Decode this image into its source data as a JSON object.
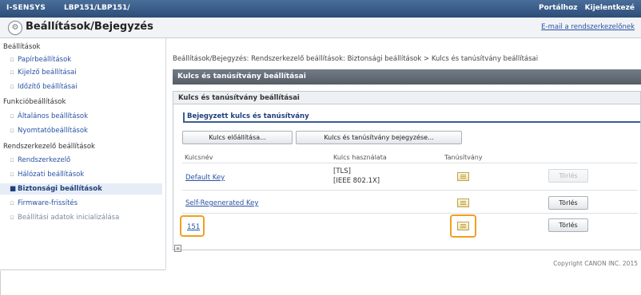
{
  "topbar": {
    "brand": "I-SENSYS",
    "model": "LBP151/LBP151/",
    "links": [
      "Portálhoz",
      "Kijelentkezé"
    ]
  },
  "titlebar": {
    "icon": "gear-icon",
    "title": "Beállítások/Bejegyzés",
    "mail_link": "E-mail a rendszerkezelőnek"
  },
  "sidebar": {
    "groups": [
      {
        "label": "Beállítások",
        "items": [
          "Papírbeállítások",
          "Kijelző beállításai",
          "Időzítő beállításai"
        ]
      },
      {
        "label": "Funkcióbeállítások",
        "items": [
          "Általános beállítások",
          "Nyomtatóbeállítások"
        ]
      },
      {
        "label": "Rendszerkezelő beállítások",
        "items": [
          "Rendszerkezelő",
          "Hálózati beállítások",
          "Biztonsági beállítások",
          "Firmware-frissítés",
          "Beállítási adatok inicializálása"
        ]
      }
    ]
  },
  "breadcrumb": "Beállítások/Bejegyzés: Rendszerkezelő beállítások: Biztonsági beállítások > Kulcs és tanúsítvány beállításai",
  "header": "Kulcs és tanúsítvány beállításai",
  "panel": {
    "title": "Kulcs és tanúsítvány beállításai",
    "subhead": "Bejegyzett kulcs és tanúsítvány",
    "buttons": {
      "generate": "Kulcs előállítása...",
      "register": "Kulcs és tanúsítvány bejegyzése..."
    },
    "columns": [
      "Kulcsnév",
      "Kulcs használata",
      "Tanúsítvány"
    ],
    "rows": [
      {
        "name": "Default Key",
        "usage_line1": "[TLS]",
        "usage_line2": "[IEEE 802.1X]",
        "delete": "Törlés",
        "delete_enabled": false
      },
      {
        "name": "Self-Regenerated Key",
        "usage_line1": "",
        "usage_line2": "",
        "delete": "Törlés",
        "delete_enabled": true
      },
      {
        "name": "151",
        "usage_line1": "",
        "usage_line2": "",
        "delete": "Törlés",
        "delete_enabled": true
      }
    ]
  },
  "highlight_color": "#f0a020",
  "copyright": "Copyright CANON INC. 2015"
}
